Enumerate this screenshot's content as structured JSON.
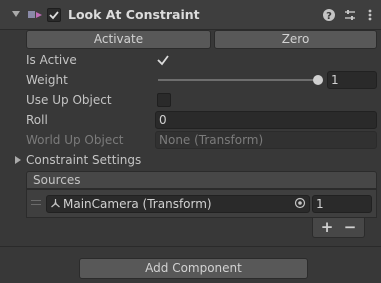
{
  "component": {
    "title": "Look At Constraint",
    "enabled": true
  },
  "buttons": {
    "activate": "Activate",
    "zero": "Zero",
    "add_component": "Add Component"
  },
  "properties": {
    "is_active": {
      "label": "Is Active",
      "checked": true
    },
    "weight": {
      "label": "Weight",
      "value": "1",
      "slider_fraction": 1.0
    },
    "use_up_object": {
      "label": "Use Up Object",
      "checked": false
    },
    "roll": {
      "label": "Roll",
      "value": "0"
    },
    "world_up_object": {
      "label": "World Up Object",
      "value": "None (Transform)"
    }
  },
  "constraint_settings": {
    "label": "Constraint Settings",
    "expanded": false
  },
  "sources": {
    "header": "Sources",
    "items": [
      {
        "object": "MainCamera (Transform)",
        "weight": "1"
      }
    ],
    "add_label": "+",
    "remove_label": "−"
  },
  "icons": [
    "fold-arrow-icon",
    "constraint-icon",
    "enabled-checkbox",
    "help-icon",
    "presets-icon",
    "menu-icon",
    "checkmark-icon",
    "expand-arrow-icon",
    "drag-handle-icon",
    "transform-icon",
    "object-picker-icon"
  ],
  "colors": {
    "background": "#383838",
    "header": "#3e3e3e",
    "field": "#2a2a2a",
    "button": "#585858"
  }
}
